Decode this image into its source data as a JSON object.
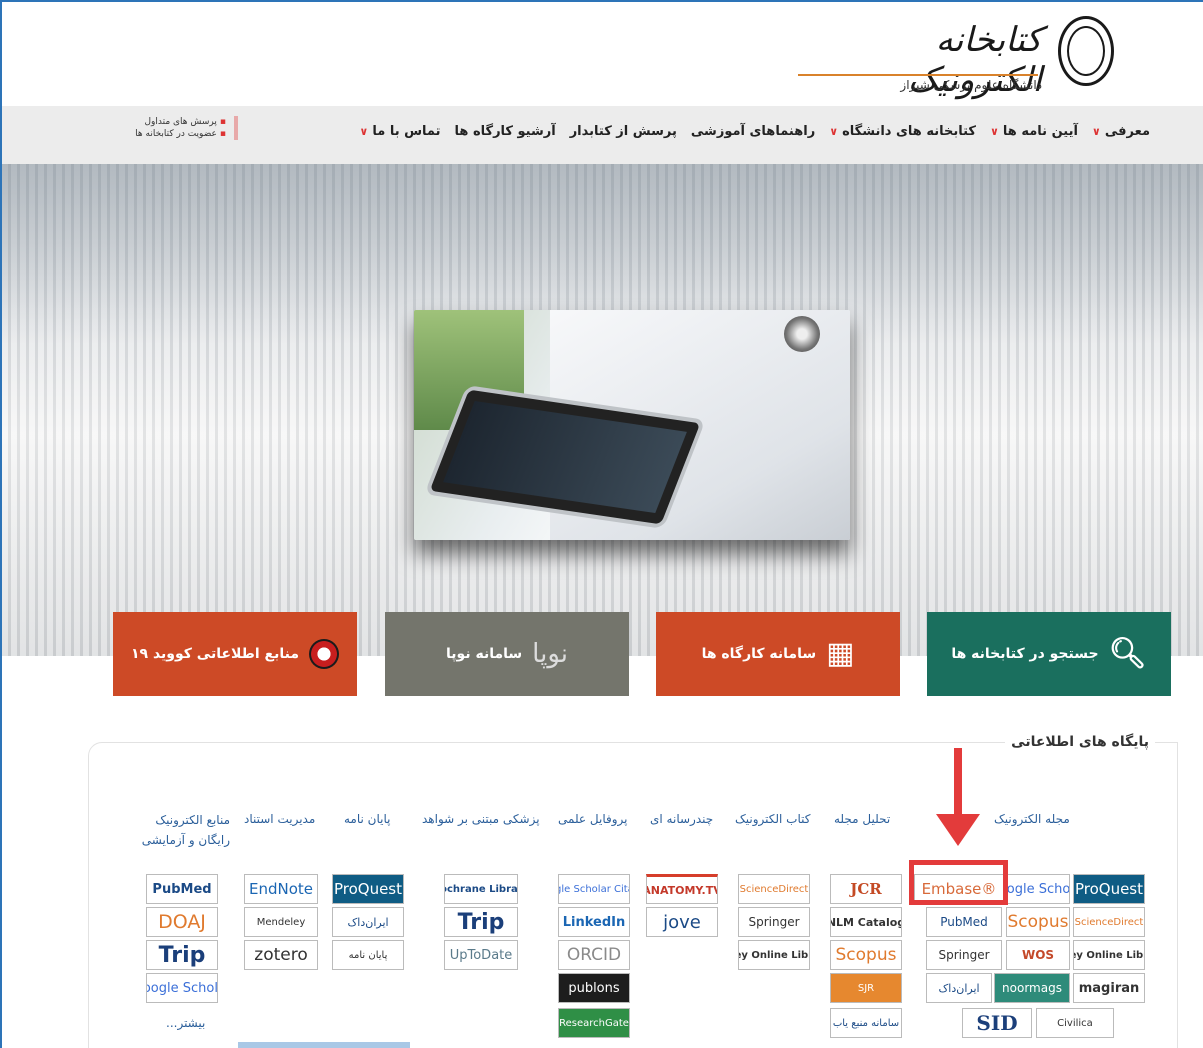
{
  "header": {
    "title": "کتابخانه الکترونیک",
    "subtitle": "دانشگاه علوم پزشکی شیراز"
  },
  "nav": {
    "items": [
      {
        "label": "معرفی",
        "has_dropdown": true
      },
      {
        "label": "آیین نامه ها",
        "has_dropdown": true
      },
      {
        "label": "کتابخانه های دانشگاه",
        "has_dropdown": true
      },
      {
        "label": "راهنماهای آموزشی",
        "has_dropdown": false
      },
      {
        "label": "پرسش از کتابدار",
        "has_dropdown": false
      },
      {
        "label": "آرشیو کارگاه ها",
        "has_dropdown": false
      },
      {
        "label": "تماس با ما",
        "has_dropdown": true
      }
    ],
    "side_links": [
      "پرسش های متداول",
      "عضویت در کتابخانه ها"
    ]
  },
  "tiles": {
    "search": "جستجو در کتابخانه ها",
    "workshops": "سامانه کارگاه ها",
    "nopa": "سامانه نوپا",
    "nopa_logo": "نوپا",
    "covid": "منابع اطلاعاتی کووید ۱۹"
  },
  "databases": {
    "title": "پایگاه های اطلاعاتی",
    "categories": {
      "ejournal": "مجله الکترونیک",
      "journal_analysis": "تحلیل مجله",
      "ebook": "کتاب الکترونیک",
      "multimedia": "چندرسانه ای",
      "scientific_profile": "پروفایل علمی",
      "ebm": "پزشکی مبتنی بر شواهد",
      "thesis": "پایان نامه",
      "citation_mgmt": "مدیریت استناد",
      "free_resources_1": "منابع الکترونیک",
      "free_resources_2": "رایگان و آزمایشی"
    },
    "ejournal": [
      "ProQuest",
      "Google Scholar",
      "Embase®",
      "ScienceDirect",
      "Scopus",
      "PubMed",
      "Wiley Online Library",
      "WOS",
      "Springer",
      "magiran",
      "noormags",
      "ایران‌داک",
      "Civilica",
      "SID"
    ],
    "journal_analysis": [
      "JCR",
      "NLM Catalog",
      "Scopus",
      "SJR",
      "سامانه منبع یاب"
    ],
    "ebook": [
      "ScienceDirect",
      "Springer",
      "Wiley Online Library"
    ],
    "multimedia": [
      "ANATOMY.TV",
      "jove"
    ],
    "scientific_profile": [
      "Google Scholar Citation",
      "LinkedIn",
      "ORCID",
      "publons",
      "ResearchGate"
    ],
    "ebm": [
      "Cochrane Library",
      "Trip",
      "UpToDate"
    ],
    "thesis": [
      "ProQuest",
      "ایران‌داک",
      "پایان نامه"
    ],
    "citation_mgmt": [
      "EndNote",
      "Mendeley",
      "zotero"
    ],
    "free": [
      "PubMed",
      "DOAJ",
      "Trip",
      "Google Scholar"
    ],
    "more": "بیشتر..."
  }
}
